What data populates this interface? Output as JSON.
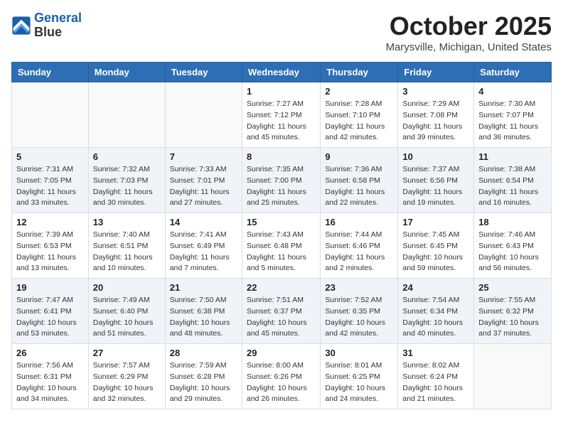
{
  "header": {
    "logo_line1": "General",
    "logo_line2": "Blue",
    "month": "October 2025",
    "location": "Marysville, Michigan, United States"
  },
  "weekdays": [
    "Sunday",
    "Monday",
    "Tuesday",
    "Wednesday",
    "Thursday",
    "Friday",
    "Saturday"
  ],
  "weeks": [
    [
      {
        "day": "",
        "info": ""
      },
      {
        "day": "",
        "info": ""
      },
      {
        "day": "",
        "info": ""
      },
      {
        "day": "1",
        "info": "Sunrise: 7:27 AM\nSunset: 7:12 PM\nDaylight: 11 hours\nand 45 minutes."
      },
      {
        "day": "2",
        "info": "Sunrise: 7:28 AM\nSunset: 7:10 PM\nDaylight: 11 hours\nand 42 minutes."
      },
      {
        "day": "3",
        "info": "Sunrise: 7:29 AM\nSunset: 7:08 PM\nDaylight: 11 hours\nand 39 minutes."
      },
      {
        "day": "4",
        "info": "Sunrise: 7:30 AM\nSunset: 7:07 PM\nDaylight: 11 hours\nand 36 minutes."
      }
    ],
    [
      {
        "day": "5",
        "info": "Sunrise: 7:31 AM\nSunset: 7:05 PM\nDaylight: 11 hours\nand 33 minutes."
      },
      {
        "day": "6",
        "info": "Sunrise: 7:32 AM\nSunset: 7:03 PM\nDaylight: 11 hours\nand 30 minutes."
      },
      {
        "day": "7",
        "info": "Sunrise: 7:33 AM\nSunset: 7:01 PM\nDaylight: 11 hours\nand 27 minutes."
      },
      {
        "day": "8",
        "info": "Sunrise: 7:35 AM\nSunset: 7:00 PM\nDaylight: 11 hours\nand 25 minutes."
      },
      {
        "day": "9",
        "info": "Sunrise: 7:36 AM\nSunset: 6:58 PM\nDaylight: 11 hours\nand 22 minutes."
      },
      {
        "day": "10",
        "info": "Sunrise: 7:37 AM\nSunset: 6:56 PM\nDaylight: 11 hours\nand 19 minutes."
      },
      {
        "day": "11",
        "info": "Sunrise: 7:38 AM\nSunset: 6:54 PM\nDaylight: 11 hours\nand 16 minutes."
      }
    ],
    [
      {
        "day": "12",
        "info": "Sunrise: 7:39 AM\nSunset: 6:53 PM\nDaylight: 11 hours\nand 13 minutes."
      },
      {
        "day": "13",
        "info": "Sunrise: 7:40 AM\nSunset: 6:51 PM\nDaylight: 11 hours\nand 10 minutes."
      },
      {
        "day": "14",
        "info": "Sunrise: 7:41 AM\nSunset: 6:49 PM\nDaylight: 11 hours\nand 7 minutes."
      },
      {
        "day": "15",
        "info": "Sunrise: 7:43 AM\nSunset: 6:48 PM\nDaylight: 11 hours\nand 5 minutes."
      },
      {
        "day": "16",
        "info": "Sunrise: 7:44 AM\nSunset: 6:46 PM\nDaylight: 11 hours\nand 2 minutes."
      },
      {
        "day": "17",
        "info": "Sunrise: 7:45 AM\nSunset: 6:45 PM\nDaylight: 10 hours\nand 59 minutes."
      },
      {
        "day": "18",
        "info": "Sunrise: 7:46 AM\nSunset: 6:43 PM\nDaylight: 10 hours\nand 56 minutes."
      }
    ],
    [
      {
        "day": "19",
        "info": "Sunrise: 7:47 AM\nSunset: 6:41 PM\nDaylight: 10 hours\nand 53 minutes."
      },
      {
        "day": "20",
        "info": "Sunrise: 7:49 AM\nSunset: 6:40 PM\nDaylight: 10 hours\nand 51 minutes."
      },
      {
        "day": "21",
        "info": "Sunrise: 7:50 AM\nSunset: 6:38 PM\nDaylight: 10 hours\nand 48 minutes."
      },
      {
        "day": "22",
        "info": "Sunrise: 7:51 AM\nSunset: 6:37 PM\nDaylight: 10 hours\nand 45 minutes."
      },
      {
        "day": "23",
        "info": "Sunrise: 7:52 AM\nSunset: 6:35 PM\nDaylight: 10 hours\nand 42 minutes."
      },
      {
        "day": "24",
        "info": "Sunrise: 7:54 AM\nSunset: 6:34 PM\nDaylight: 10 hours\nand 40 minutes."
      },
      {
        "day": "25",
        "info": "Sunrise: 7:55 AM\nSunset: 6:32 PM\nDaylight: 10 hours\nand 37 minutes."
      }
    ],
    [
      {
        "day": "26",
        "info": "Sunrise: 7:56 AM\nSunset: 6:31 PM\nDaylight: 10 hours\nand 34 minutes."
      },
      {
        "day": "27",
        "info": "Sunrise: 7:57 AM\nSunset: 6:29 PM\nDaylight: 10 hours\nand 32 minutes."
      },
      {
        "day": "28",
        "info": "Sunrise: 7:59 AM\nSunset: 6:28 PM\nDaylight: 10 hours\nand 29 minutes."
      },
      {
        "day": "29",
        "info": "Sunrise: 8:00 AM\nSunset: 6:26 PM\nDaylight: 10 hours\nand 26 minutes."
      },
      {
        "day": "30",
        "info": "Sunrise: 8:01 AM\nSunset: 6:25 PM\nDaylight: 10 hours\nand 24 minutes."
      },
      {
        "day": "31",
        "info": "Sunrise: 8:02 AM\nSunset: 6:24 PM\nDaylight: 10 hours\nand 21 minutes."
      },
      {
        "day": "",
        "info": ""
      }
    ]
  ]
}
